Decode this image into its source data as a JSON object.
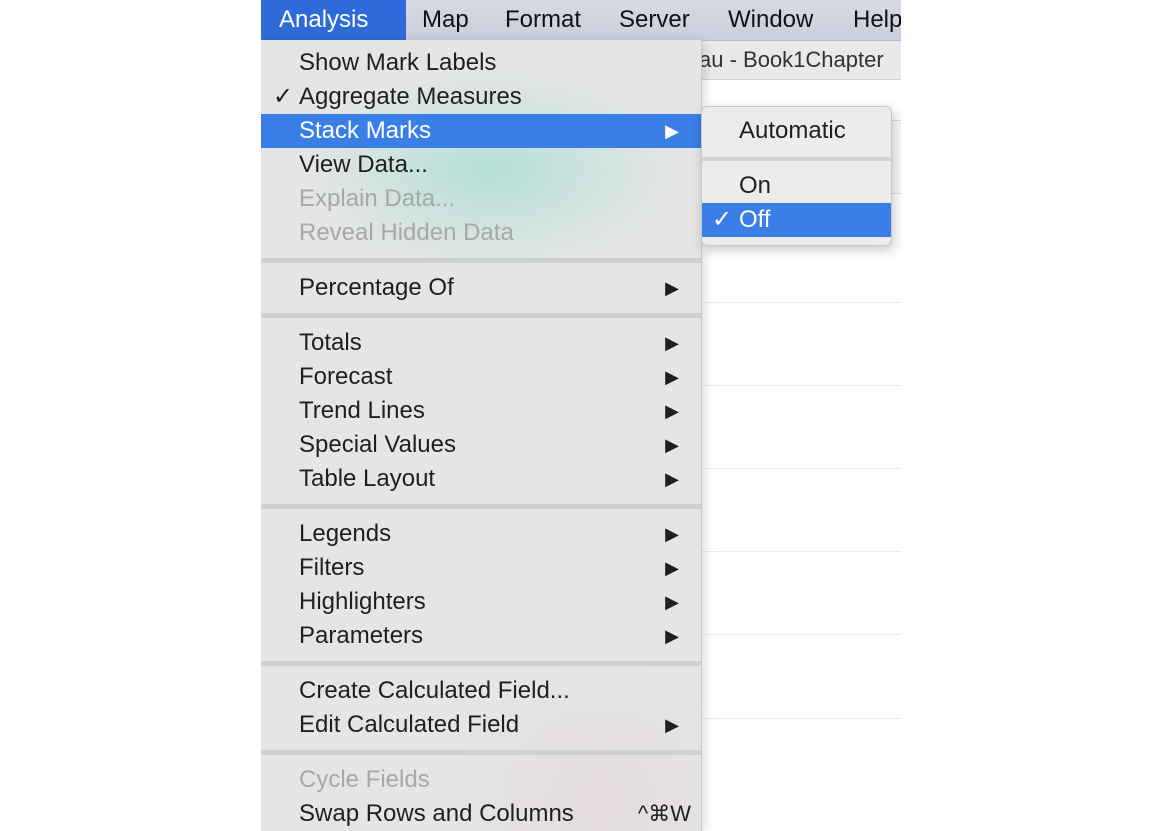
{
  "menubar": {
    "items": [
      {
        "label": "Analysis",
        "active": true
      },
      {
        "label": "Map"
      },
      {
        "label": "Format"
      },
      {
        "label": "Server"
      },
      {
        "label": "Window"
      },
      {
        "label": "Help"
      }
    ]
  },
  "window": {
    "title_fragment": "au - Book1Chapter"
  },
  "analysis_menu": {
    "show_mark_labels": "Show Mark Labels",
    "aggregate_measures": "Aggregate Measures",
    "aggregate_check": "✓",
    "stack_marks": "Stack Marks",
    "view_data": "View Data...",
    "explain_data": "Explain Data...",
    "reveal_hidden_data": "Reveal Hidden Data",
    "percentage_of": "Percentage Of",
    "totals": "Totals",
    "forecast": "Forecast",
    "trend_lines": "Trend Lines",
    "special_values": "Special Values",
    "table_layout": "Table Layout",
    "legends": "Legends",
    "filters": "Filters",
    "highlighters": "Highlighters",
    "parameters": "Parameters",
    "create_calculated_field": "Create Calculated Field...",
    "edit_calculated_field": "Edit Calculated Field",
    "cycle_fields": "Cycle Fields",
    "swap_rows_columns": "Swap Rows and Columns",
    "swap_shortcut": "^⌘W",
    "submenu_arrow": "▶"
  },
  "stack_marks_submenu": {
    "automatic": "Automatic",
    "on": "On",
    "off": "Off",
    "off_check": "✓",
    "selected": "Off"
  },
  "colors": {
    "menubar_active": "#2f6bd8",
    "highlight": "#3a7ee8"
  }
}
